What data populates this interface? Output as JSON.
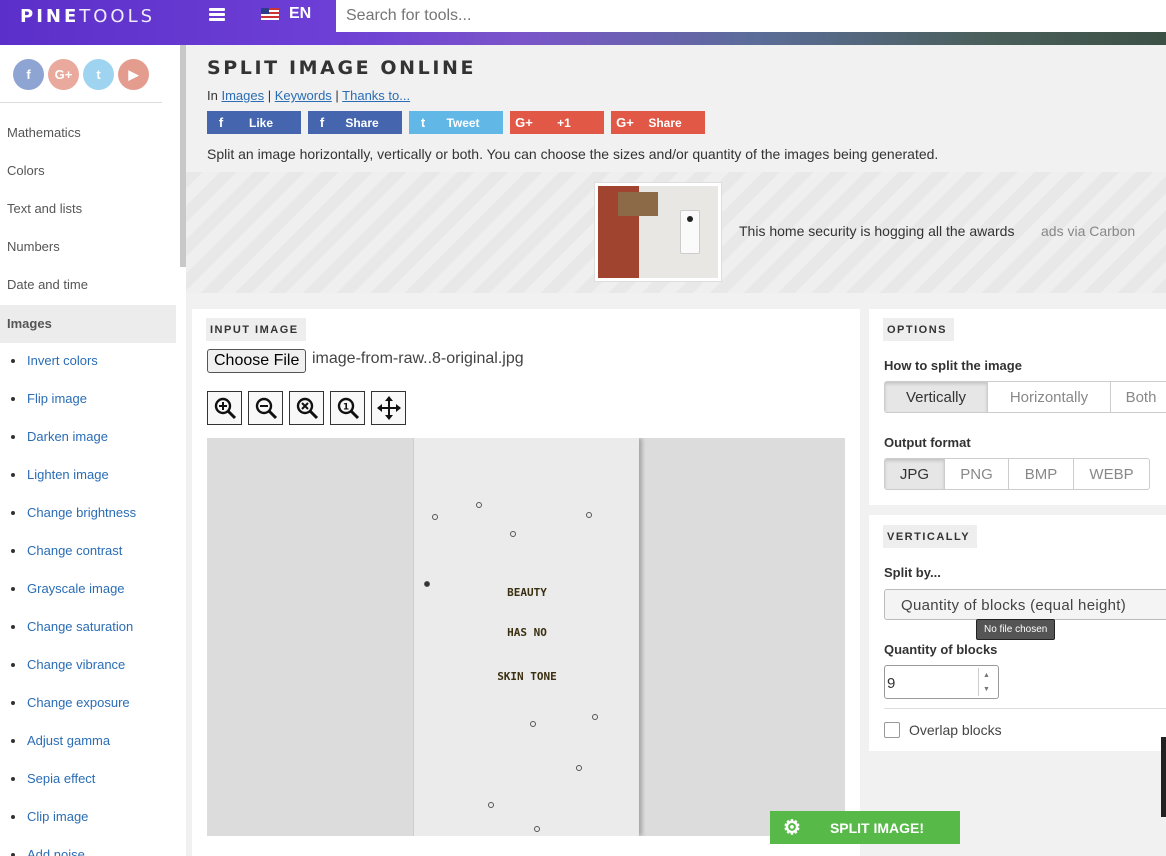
{
  "header": {
    "logo_bold": "PINE",
    "logo_light": "TOOLS",
    "language": "EN",
    "search_placeholder": "Search for tools..."
  },
  "sidebar": {
    "socials": [
      "f",
      "G+",
      "t",
      "▶"
    ],
    "categories": [
      "Mathematics",
      "Colors",
      "Text and lists",
      "Numbers",
      "Date and time"
    ],
    "active_category": "Images",
    "items": [
      "Invert colors",
      "Flip image",
      "Darken image",
      "Lighten image",
      "Change brightness",
      "Change contrast",
      "Grayscale image",
      "Change saturation",
      "Change vibrance",
      "Change exposure",
      "Adjust gamma",
      "Sepia effect",
      "Clip image",
      "Add noise"
    ]
  },
  "page": {
    "title": "SPLIT IMAGE ONLINE",
    "breadcrumb_prefix": "In",
    "breadcrumb_links": [
      "Images",
      "Keywords",
      "Thanks to..."
    ],
    "share_buttons": [
      {
        "icon": "f",
        "label": "Like"
      },
      {
        "icon": "f",
        "label": "Share"
      },
      {
        "icon": "t",
        "label": "Tweet"
      },
      {
        "icon": "G+",
        "label": "+1"
      },
      {
        "icon": "G+",
        "label": "Share"
      }
    ],
    "description": "Split an image horizontally, vertically or both. You can choose the sizes and/or quantity of the images being generated."
  },
  "ad": {
    "text": "This home security is hogging all the awards",
    "via": "ads via Carbon"
  },
  "input_panel": {
    "heading": "INPUT IMAGE",
    "choose_file": "Choose File",
    "file_name": "image-from-raw..8-original.jpg",
    "preview_lines": [
      "BEAUTY",
      "HAS NO",
      "SKIN TONE"
    ]
  },
  "options": {
    "heading": "OPTIONS",
    "split_label": "How to split the image",
    "split_modes": [
      "Vertically",
      "Horizontally",
      "Both"
    ],
    "split_selected": "Vertically",
    "format_label": "Output format",
    "formats": [
      "JPG",
      "PNG",
      "BMP",
      "WEBP"
    ],
    "format_selected": "JPG"
  },
  "vertical": {
    "heading": "VERTICALLY",
    "split_by_label": "Split by...",
    "split_by_value": "Quantity of blocks (equal height)",
    "tooltip": "No file chosen",
    "quantity_label": "Quantity of blocks",
    "quantity_value": "9",
    "overlap_label": "Overlap blocks",
    "overlap_checked": false
  },
  "action": {
    "split_label": "SPLIT IMAGE!"
  },
  "colors": {
    "accent_green": "#56b948",
    "link_blue": "#2a6db5",
    "facebook": "#4566ae",
    "twitter": "#61b7e6",
    "google": "#e15847"
  }
}
